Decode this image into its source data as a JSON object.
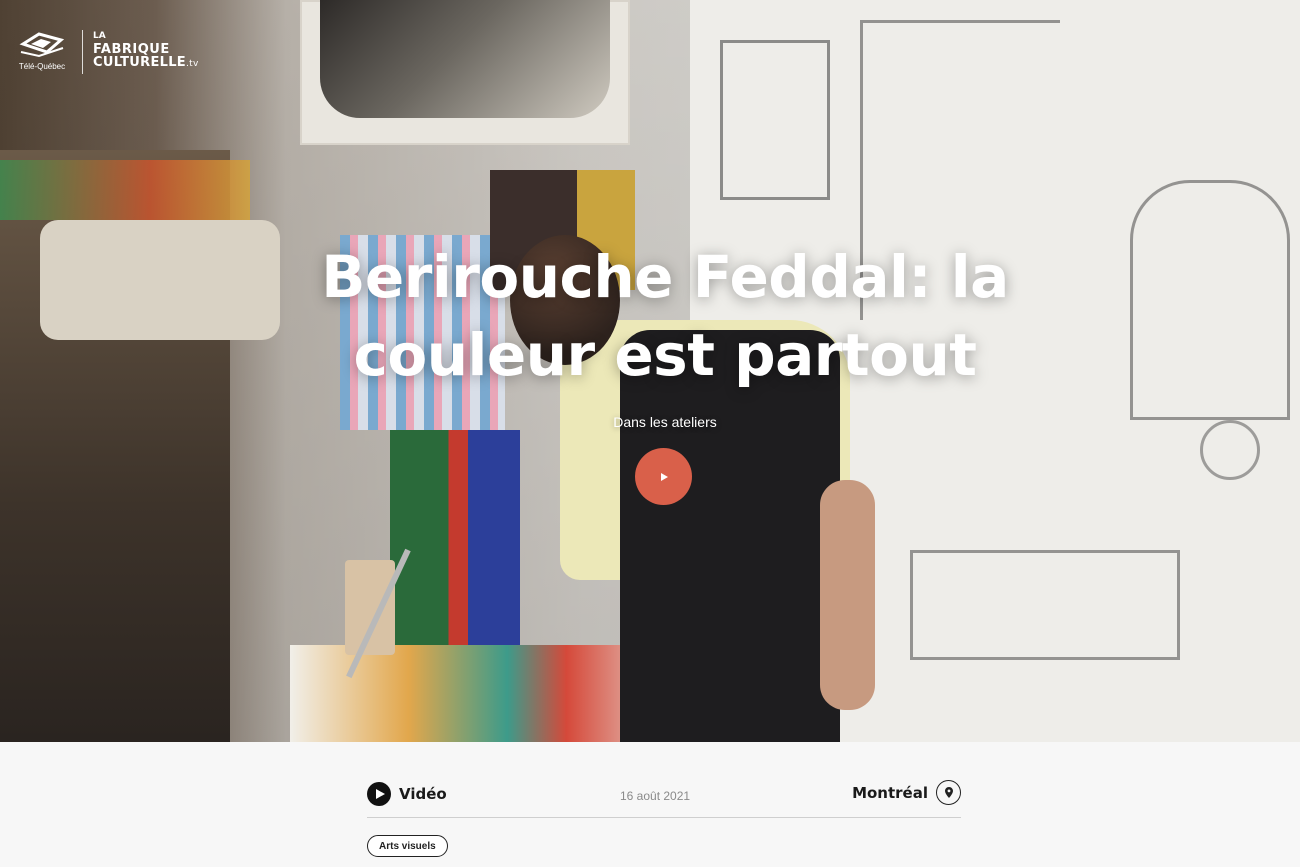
{
  "brand": {
    "broadcaster": "Télé-Québec",
    "logo_line1": "LA",
    "logo_line2": "FABRIQUE",
    "logo_line3": "CULTURELLE",
    "logo_suffix": ".tv"
  },
  "hero": {
    "title": "Berirouche Feddal: la couleur est partout",
    "series": "Dans les ateliers",
    "play_icon": "play-icon",
    "accent_color": "#d9604a"
  },
  "meta": {
    "type_label": "Vidéo",
    "date": "16 août 2021",
    "location": "Montréal"
  },
  "tags": [
    "Arts visuels"
  ]
}
